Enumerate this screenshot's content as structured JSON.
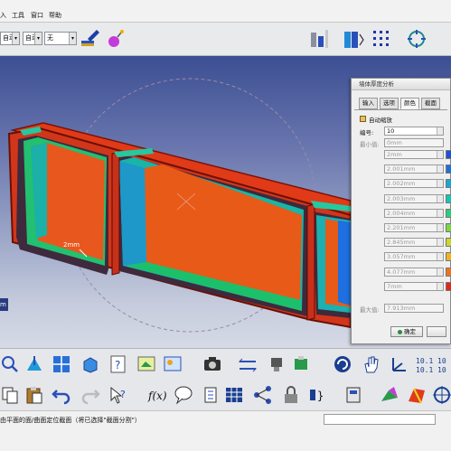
{
  "menubar": {
    "items": [
      "入",
      "工具",
      "窗口",
      "帮助"
    ]
  },
  "toolbar": {
    "combo1": "自动",
    "combo2": "自动",
    "combo3": "无"
  },
  "viewport": {
    "measure_label": "2mm",
    "partial_label": "m"
  },
  "dialog": {
    "title": "墙体厚度分析",
    "tabs": [
      "输入",
      "选项",
      "颜色",
      "截面"
    ],
    "auto_scale_label": "自动缩放",
    "count_label": "编号:",
    "count_value": "10",
    "min_label": "最小值:",
    "min_value": "0mm",
    "max_label": "最大值:",
    "max_value": "7.913mm",
    "levels": [
      "2mm",
      "2.001mm",
      "2.002mm",
      "2.003mm",
      "2.004mm",
      "2.201mm",
      "2.845mm",
      "3.057mm",
      "4.077mm",
      "7mm"
    ],
    "level_colors": [
      "#1d4fd8",
      "#1d6fe0",
      "#17a7d2",
      "#12c7b0",
      "#28cf7a",
      "#7bd742",
      "#c7d82e",
      "#f0b224",
      "#f0721e",
      "#e0281e"
    ],
    "ok_label": "确定"
  },
  "status": {
    "message": "由平面的面/曲面定位截面（将已选择\"截面分割\"）"
  }
}
